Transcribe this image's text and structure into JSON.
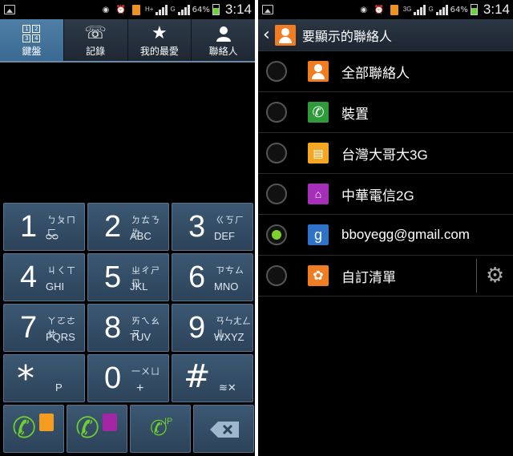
{
  "status_bar": {
    "battery_pct": "64%",
    "time": "3:14",
    "net_left": "H+",
    "net_right": "3G",
    "sig_label": "G"
  },
  "dialer": {
    "tabs": [
      {
        "label": "鍵盤",
        "icon": "keypad-icon",
        "active": true
      },
      {
        "label": "記錄",
        "icon": "call-log-icon",
        "active": false
      },
      {
        "label": "我的最愛",
        "icon": "star-icon",
        "active": false
      },
      {
        "label": "聯絡人",
        "icon": "contact-icon",
        "active": false
      }
    ],
    "keypad_icon_digits": [
      "1",
      "2",
      "3",
      "4"
    ],
    "keys": [
      {
        "digit": "1",
        "zh": "ㄅㄆㄇㄈ",
        "en": "QO"
      },
      {
        "digit": "2",
        "zh": "ㄉㄊㄋㄌ",
        "en": "ABC"
      },
      {
        "digit": "3",
        "zh": "ㄍㄎㄏ",
        "en": "DEF"
      },
      {
        "digit": "4",
        "zh": "ㄐㄑㄒ",
        "en": "GHI"
      },
      {
        "digit": "5",
        "zh": "ㄓㄔㄕㄖ",
        "en": "JKL"
      },
      {
        "digit": "6",
        "zh": "ㄗㄘㄙ",
        "en": "MNO"
      },
      {
        "digit": "7",
        "zh": "ㄚㄛㄜㄝ",
        "en": "PQRS"
      },
      {
        "digit": "8",
        "zh": "ㄞㄟㄠㄡ",
        "en": "TUV"
      },
      {
        "digit": "9",
        "zh": "ㄢㄣㄤㄥㄦ",
        "en": "WXYZ"
      },
      {
        "digit": "*",
        "zh": "",
        "en": "P"
      },
      {
        "digit": "0",
        "zh": "一ㄨㄩ",
        "en": "+"
      },
      {
        "digit": "#",
        "zh": "",
        "en": ""
      }
    ],
    "actions": [
      {
        "name": "call-sim1-button",
        "badge_color": "#f39c1f"
      },
      {
        "name": "call-sim2-button",
        "badge_color": "#a226a6"
      },
      {
        "name": "ip-call-button",
        "label": "IP"
      },
      {
        "name": "backspace-button"
      }
    ]
  },
  "contacts_filter": {
    "title": "要顯示的聯絡人",
    "items": [
      {
        "label": "全部聯絡人",
        "icon": "contacts-icon",
        "color": "#f07d22",
        "selected": false
      },
      {
        "label": "裝置",
        "icon": "phone-device-icon",
        "color": "#2f9a3a",
        "selected": false
      },
      {
        "label": "台灣大哥大3G",
        "icon": "sim-card-icon",
        "color": "#f5a623",
        "selected": false
      },
      {
        "label": "中華電信2G",
        "icon": "sim-home-icon",
        "color": "#a52fb8",
        "selected": false
      },
      {
        "label": "bboyegg@gmail.com",
        "icon": "google-icon",
        "icon_text": "g",
        "color": "#2e73c7",
        "selected": true
      },
      {
        "label": "自訂清單",
        "icon": "custom-settings-icon",
        "color": "#f07d22",
        "selected": false
      }
    ]
  }
}
